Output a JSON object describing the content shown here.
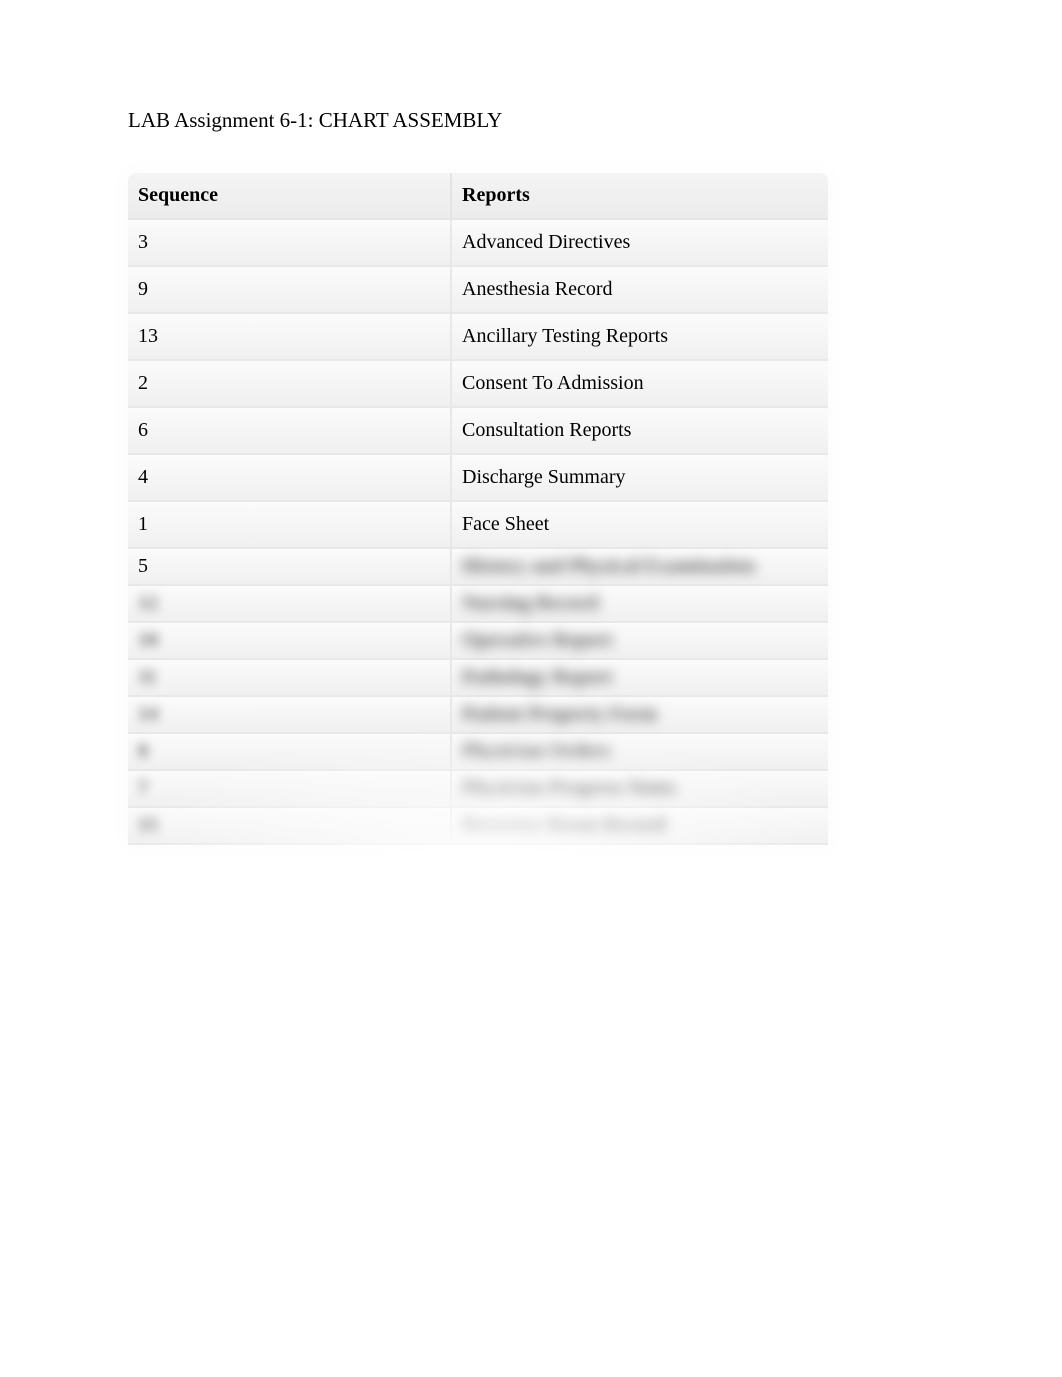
{
  "title": "LAB Assignment 6-1: CHART ASSEMBLY",
  "headers": {
    "sequence": "Sequence",
    "reports": "Reports"
  },
  "rows": [
    {
      "sequence": "3",
      "report": "Advanced Directives",
      "blurred": false
    },
    {
      "sequence": "9",
      "report": "Anesthesia Record",
      "blurred": false
    },
    {
      "sequence": "13",
      "report": "Ancillary Testing Reports",
      "blurred": false
    },
    {
      "sequence": "2",
      "report": "Consent To Admission",
      "blurred": false
    },
    {
      "sequence": "6",
      "report": "Consultation Reports",
      "blurred": false
    },
    {
      "sequence": "4",
      "report": "Discharge Summary",
      "blurred": false
    },
    {
      "sequence": "1",
      "report": "Face Sheet",
      "blurred": false
    },
    {
      "sequence": "5",
      "report": "History and Physical Examination",
      "blurred": true,
      "seqBlurred": false
    },
    {
      "sequence": "12",
      "report": "Nursing Record",
      "blurred": true,
      "seqBlurred": true
    },
    {
      "sequence": "10",
      "report": "Operative Report",
      "blurred": true,
      "seqBlurred": true
    },
    {
      "sequence": "11",
      "report": "Pathology Report",
      "blurred": true,
      "seqBlurred": true
    },
    {
      "sequence": "14",
      "report": "Patient Property Form",
      "blurred": true,
      "seqBlurred": true
    },
    {
      "sequence": "8",
      "report": "Physician Orders",
      "blurred": true,
      "seqBlurred": true
    },
    {
      "sequence": "7",
      "report": "Physician Progress Notes",
      "blurred": true,
      "seqBlurred": true
    },
    {
      "sequence": "15",
      "report": "Recovery Room Record",
      "blurred": true,
      "seqBlurred": true
    }
  ]
}
